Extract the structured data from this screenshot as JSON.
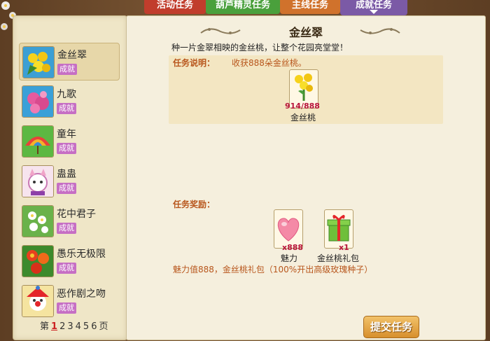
{
  "tabs": [
    {
      "label": "活动任务"
    },
    {
      "label": "葫芦精灵任务"
    },
    {
      "label": "主线任务"
    },
    {
      "label": "成就任务"
    }
  ],
  "task_list": [
    {
      "name": "金丝翠",
      "badge": "成就",
      "icon": "golden-flower-icon"
    },
    {
      "name": "九歌",
      "badge": "成就",
      "icon": "pink-flower-icon"
    },
    {
      "name": "童年",
      "badge": "成就",
      "icon": "rainbow-umbrella-icon"
    },
    {
      "name": "蛊蛊",
      "badge": "成就",
      "icon": "cat-doll-icon"
    },
    {
      "name": "花中君子",
      "badge": "成就",
      "icon": "white-blossom-icon"
    },
    {
      "name": "愚乐无极限",
      "badge": "成就",
      "icon": "red-flower-icon"
    },
    {
      "name": "恶作剧之吻",
      "badge": "成就",
      "icon": "clown-icon"
    }
  ],
  "pager": {
    "prefix": "第",
    "pages": [
      "1",
      "2",
      "3",
      "4",
      "5",
      "6"
    ],
    "current": "1",
    "suffix": "页"
  },
  "detail": {
    "title": "金丝翠",
    "description": "种一片金翠相映的金丝桃，让整个花园亮堂堂！",
    "task_label": "任务说明：",
    "task_text": "收获888朵金丝桃。",
    "requirement": {
      "count": "914/888",
      "name": "金丝桃",
      "icon": "golden-flower-icon"
    },
    "reward_label": "任务奖励：",
    "rewards": [
      {
        "count": "x888",
        "name": "魅力",
        "icon": "heart-icon"
      },
      {
        "count": "x1",
        "name": "金丝桃礼包",
        "icon": "gift-box-icon"
      }
    ],
    "reward_summary": "魅力值888，金丝桃礼包（100%开出高级玫瑰种子）",
    "submit_label": "提交任务"
  },
  "colors": {
    "accent_orange": "#b8561c",
    "badge_purple": "#c66fc4",
    "tab_red": "#c13d2c",
    "tab_green": "#4aa03c",
    "tab_orange": "#d0722c",
    "tab_purple": "#7b5aa6"
  }
}
